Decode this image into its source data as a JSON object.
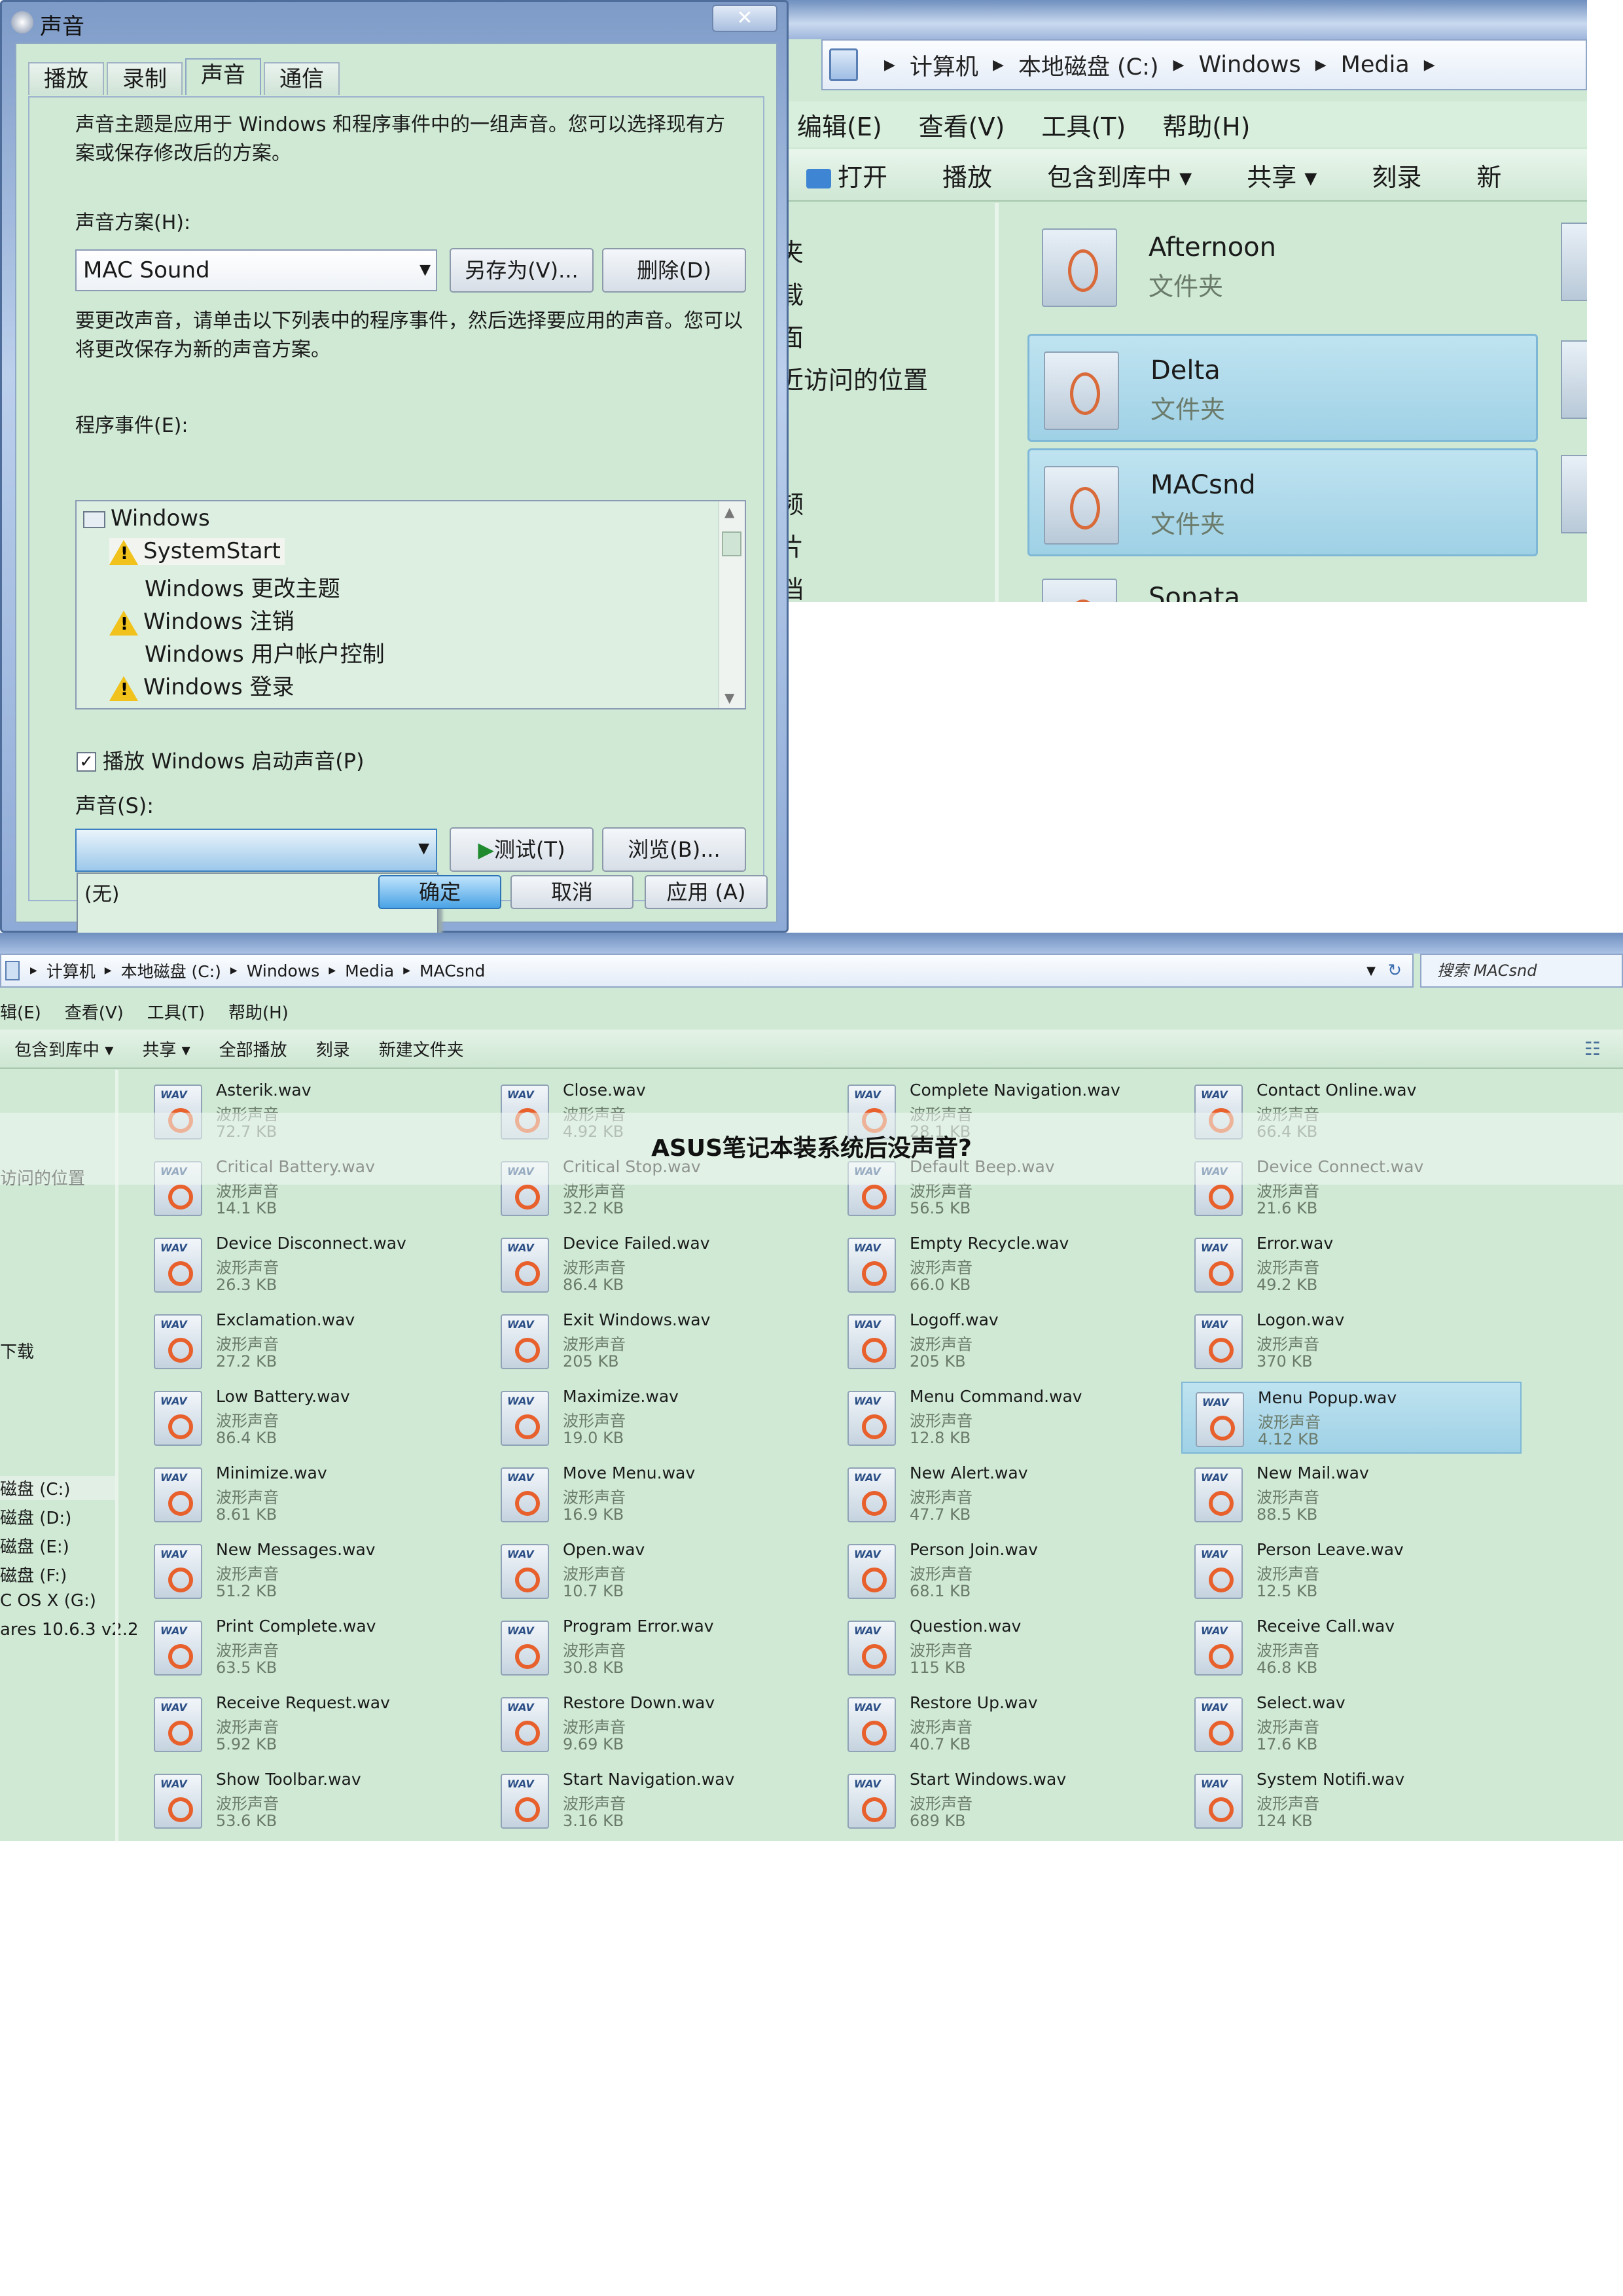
{
  "top_explorer": {
    "breadcrumb": [
      "计算机",
      "本地磁盘 (C:)",
      "Windows",
      "Media"
    ],
    "menu": [
      "编辑(E)",
      "查看(V)",
      "工具(T)",
      "帮助(H)"
    ],
    "toolbar": {
      "open": "打开",
      "play": "播放",
      "include": "包含到库中 ▾",
      "share": "共享 ▾",
      "burn": "刻录",
      "more": "新"
    },
    "nav": [
      "夹",
      "载",
      "面",
      "近访问的位置",
      "频",
      "片",
      "档"
    ],
    "folders": [
      {
        "name": "Afternoon",
        "type": "文件夹"
      },
      {
        "name": "Delta",
        "type": "文件夹"
      },
      {
        "name": "MACsnd",
        "type": "文件夹"
      },
      {
        "name": "Sonata",
        "type": ""
      }
    ]
  },
  "dialog": {
    "title": "声音",
    "close": "✕",
    "tabs": [
      "播放",
      "录制",
      "声音",
      "通信"
    ],
    "intro": "声音主题是应用于 Windows 和程序事件中的一组声音。您可以选择现有方案或保存修改后的方案。",
    "scheme_label": "声音方案(H):",
    "scheme_value": "MAC Sound",
    "save_as": "另存为(V)...",
    "delete": "删除(D)",
    "instructions": "要更改声音，请单击以下列表中的程序事件，然后选择要应用的声音。您可以将更改保存为新的声音方案。",
    "events_label": "程序事件(E):",
    "events": [
      {
        "label": "Windows",
        "warn": false
      },
      {
        "label": "SystemStart",
        "warn": true
      },
      {
        "label": "Windows 更改主题",
        "warn": false
      },
      {
        "label": "Windows 注销",
        "warn": true
      },
      {
        "label": "Windows 用户帐户控制",
        "warn": false
      },
      {
        "label": "Windows 登录",
        "warn": true
      }
    ],
    "startup_check": "✓",
    "startup_label": "播放 Windows 启动声音(P)",
    "sounds_label": "声音(S):",
    "sound_option": "(无)",
    "test": "测试(T)",
    "browse": "浏览(B)...",
    "ok": "确定",
    "cancel": "取消",
    "apply": "应用 (A)"
  },
  "bottom_explorer": {
    "breadcrumb": [
      "计算机",
      "本地磁盘 (C:)",
      "Windows",
      "Media",
      "MACsnd"
    ],
    "search_placeholder": "搜索 MACsnd",
    "menu": [
      "辑(E)",
      "查看(V)",
      "工具(T)",
      "帮助(H)"
    ],
    "toolbar": [
      "包含到库中 ▾",
      "共享 ▾",
      "全部播放",
      "刻录",
      "新建文件夹"
    ],
    "nav": [
      "访问的位置",
      "下载",
      "磁盘 (C:)",
      "磁盘 (D:)",
      "磁盘 (E:)",
      "磁盘 (F:)",
      "C OS X (G:)",
      "ares 10.6.3 v2.2"
    ],
    "files": [
      {
        "name": "Asterik.wav",
        "type": "波形声音",
        "size": "72.7 KB"
      },
      {
        "name": "Close.wav",
        "type": "波形声音",
        "size": "4.92 KB"
      },
      {
        "name": "Complete Navigation.wav",
        "type": "波形声音",
        "size": "28.1 KB"
      },
      {
        "name": "Contact Online.wav",
        "type": "波形声音",
        "size": "66.4 KB"
      },
      {
        "name": "Critical Battery.wav",
        "type": "波形声音",
        "size": "14.1 KB"
      },
      {
        "name": "Critical Stop.wav",
        "type": "波形声音",
        "size": "32.2 KB"
      },
      {
        "name": "Default Beep.wav",
        "type": "波形声音",
        "size": "56.5 KB"
      },
      {
        "name": "Device Connect.wav",
        "type": "波形声音",
        "size": "21.6 KB"
      },
      {
        "name": "Device Disconnect.wav",
        "type": "波形声音",
        "size": "26.3 KB"
      },
      {
        "name": "Device Failed.wav",
        "type": "波形声音",
        "size": "86.4 KB"
      },
      {
        "name": "Empty Recycle.wav",
        "type": "波形声音",
        "size": "66.0 KB"
      },
      {
        "name": "Error.wav",
        "type": "波形声音",
        "size": "49.2 KB"
      },
      {
        "name": "Exclamation.wav",
        "type": "波形声音",
        "size": "27.2 KB"
      },
      {
        "name": "Exit Windows.wav",
        "type": "波形声音",
        "size": "205 KB"
      },
      {
        "name": "Logoff.wav",
        "type": "波形声音",
        "size": "205 KB"
      },
      {
        "name": "Logon.wav",
        "type": "波形声音",
        "size": "370 KB"
      },
      {
        "name": "Low Battery.wav",
        "type": "波形声音",
        "size": "86.4 KB"
      },
      {
        "name": "Maximize.wav",
        "type": "波形声音",
        "size": "19.0 KB"
      },
      {
        "name": "Menu Command.wav",
        "type": "波形声音",
        "size": "12.8 KB"
      },
      {
        "name": "Menu Popup.wav",
        "type": "波形声音",
        "size": "4.12 KB"
      },
      {
        "name": "Minimize.wav",
        "type": "波形声音",
        "size": "8.61 KB"
      },
      {
        "name": "Move Menu.wav",
        "type": "波形声音",
        "size": "16.9 KB"
      },
      {
        "name": "New Alert.wav",
        "type": "波形声音",
        "size": "47.7 KB"
      },
      {
        "name": "New Mail.wav",
        "type": "波形声音",
        "size": "88.5 KB"
      },
      {
        "name": "New Messages.wav",
        "type": "波形声音",
        "size": "51.2 KB"
      },
      {
        "name": "Open.wav",
        "type": "波形声音",
        "size": "10.7 KB"
      },
      {
        "name": "Person Join.wav",
        "type": "波形声音",
        "size": "68.1 KB"
      },
      {
        "name": "Person Leave.wav",
        "type": "波形声音",
        "size": "12.5 KB"
      },
      {
        "name": "Print Complete.wav",
        "type": "波形声音",
        "size": "63.5 KB"
      },
      {
        "name": "Program Error.wav",
        "type": "波形声音",
        "size": "30.8 KB"
      },
      {
        "name": "Question.wav",
        "type": "波形声音",
        "size": "115 KB"
      },
      {
        "name": "Receive Call.wav",
        "type": "波形声音",
        "size": "46.8 KB"
      },
      {
        "name": "Receive Request.wav",
        "type": "波形声音",
        "size": "5.92 KB"
      },
      {
        "name": "Restore Down.wav",
        "type": "波形声音",
        "size": "9.69 KB"
      },
      {
        "name": "Restore Up.wav",
        "type": "波形声音",
        "size": "40.7 KB"
      },
      {
        "name": "Select.wav",
        "type": "波形声音",
        "size": "17.6 KB"
      },
      {
        "name": "Show Toolbar.wav",
        "type": "波形声音",
        "size": "53.6 KB"
      },
      {
        "name": "Start Navigation.wav",
        "type": "波形声音",
        "size": "3.16 KB"
      },
      {
        "name": "Start Windows.wav",
        "type": "波形声音",
        "size": "689 KB"
      },
      {
        "name": "System Notifi.wav",
        "type": "波形声音",
        "size": "124 KB"
      }
    ],
    "selected_file": "Menu Popup.wav"
  },
  "caption": "ASUS笔记本装系统后没声音?"
}
